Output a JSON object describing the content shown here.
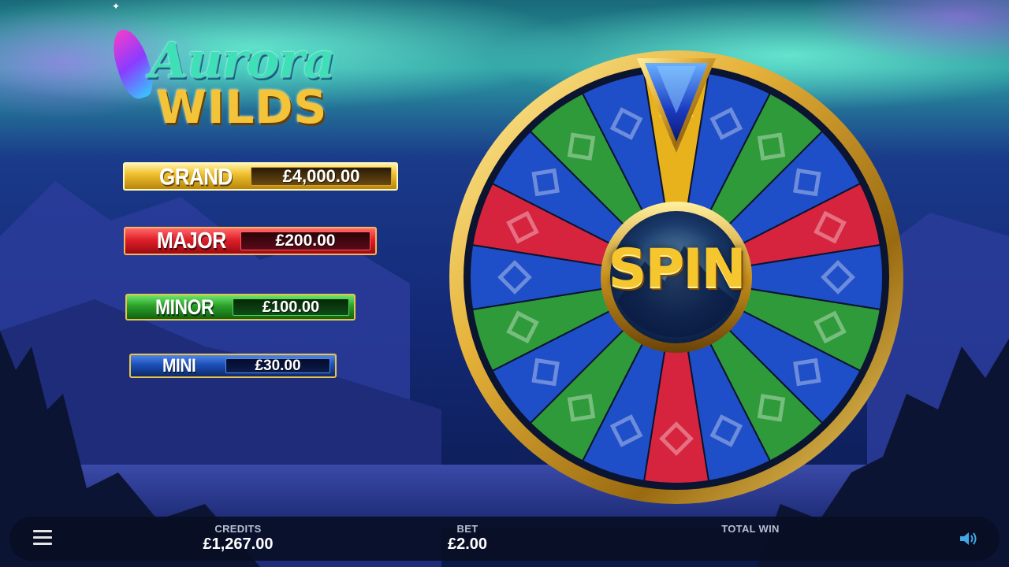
{
  "game": {
    "logo_line1": "Aurora",
    "logo_line2": "WILDS"
  },
  "jackpots": [
    {
      "label": "GRAND",
      "value": "£4,000.00",
      "color": "#f0c030"
    },
    {
      "label": "MAJOR",
      "value": "£200.00",
      "color": "#e0202a"
    },
    {
      "label": "MINOR",
      "value": "£100.00",
      "color": "#2aa02a"
    },
    {
      "label": "MINI",
      "value": "£30.00",
      "color": "#1c4fb8"
    }
  ],
  "wheel": {
    "spin_label": "SPIN",
    "segment_colors": {
      "blue": "#1f4fc8",
      "green": "#2f9a3a",
      "red": "#d6243e",
      "gold": "#e8b21c"
    },
    "pointer_icon": "gem-pointer-icon"
  },
  "bottom_bar": {
    "credits_label": "CREDITS",
    "credits_value": "£1,267.00",
    "bet_label": "BET",
    "bet_value": "£2.00",
    "total_win_label": "TOTAL WIN",
    "total_win_value": "",
    "menu_icon": "hamburger-menu-icon",
    "sound_icon": "speaker-icon"
  }
}
